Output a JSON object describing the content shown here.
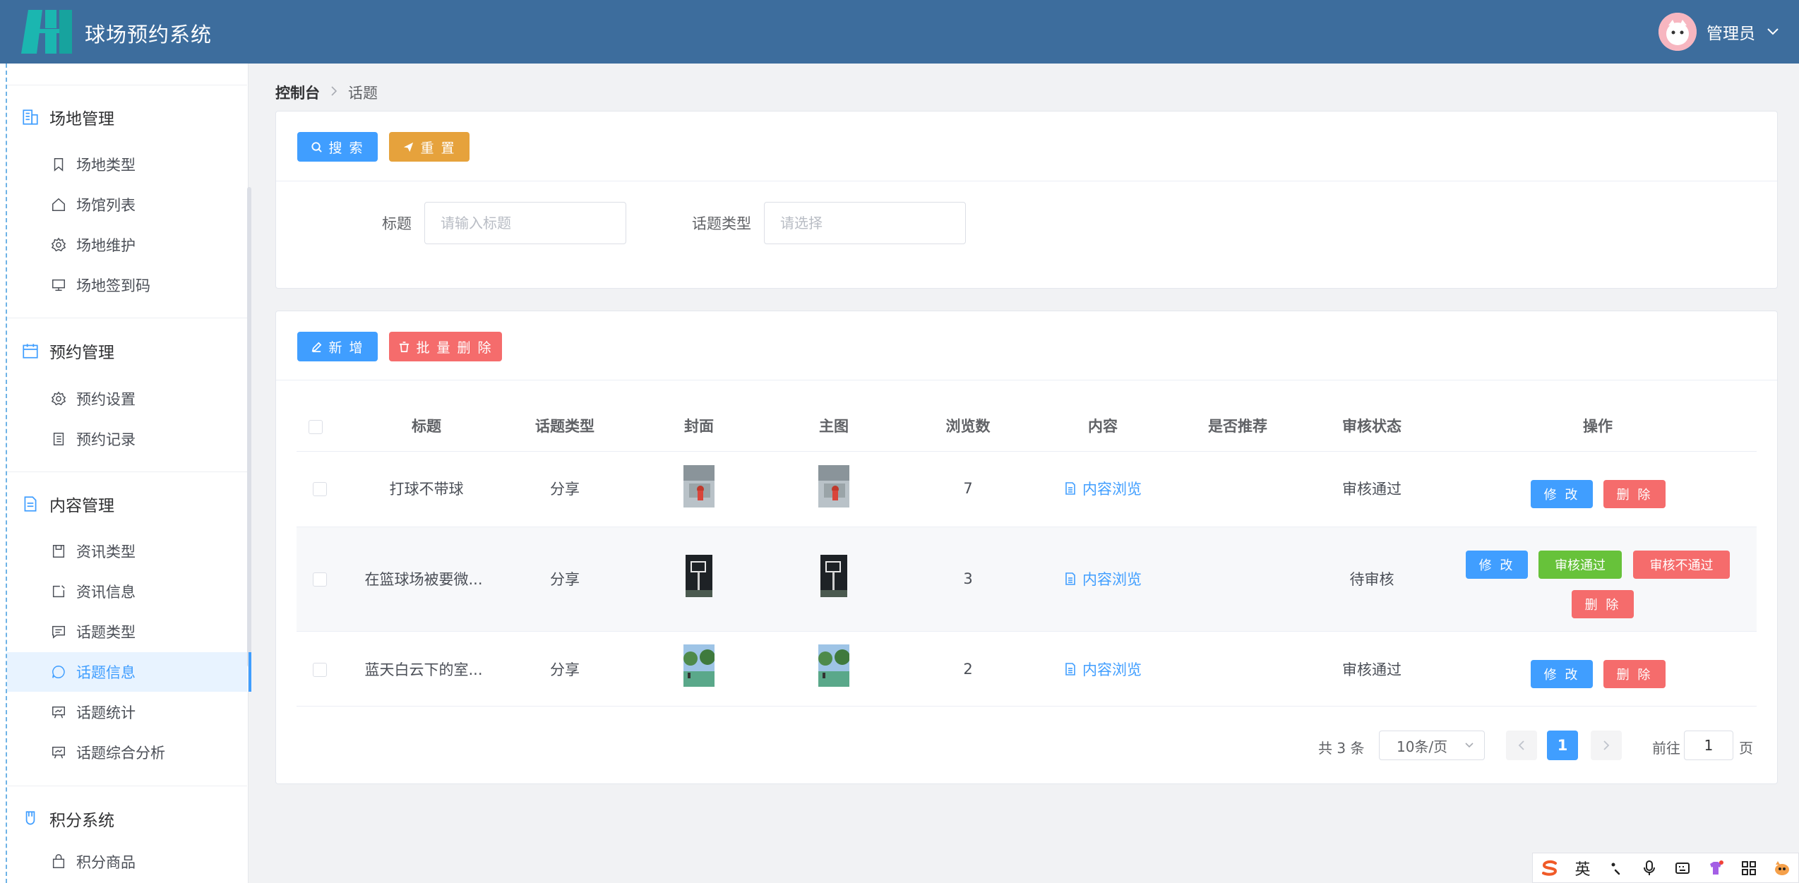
{
  "header": {
    "app_title": "球场预约系统",
    "user_name": "管理员",
    "brand_color": "#3d6d9d",
    "logo_color": "#1bb6b0"
  },
  "sidebar": {
    "groups": [
      {
        "title": "场地管理",
        "icon": "building-icon",
        "items": [
          {
            "label": "场地类型",
            "icon": "bookmark-icon"
          },
          {
            "label": "场馆列表",
            "icon": "home-icon"
          },
          {
            "label": "场地维护",
            "icon": "gear-icon"
          },
          {
            "label": "场地签到码",
            "icon": "monitor-icon"
          }
        ]
      },
      {
        "title": "预约管理",
        "icon": "calendar-icon",
        "items": [
          {
            "label": "预约设置",
            "icon": "gear-icon"
          },
          {
            "label": "预约记录",
            "icon": "notebook-icon"
          }
        ]
      },
      {
        "title": "内容管理",
        "icon": "document-icon",
        "items": [
          {
            "label": "资讯类型",
            "icon": "save-icon"
          },
          {
            "label": "资讯信息",
            "icon": "edit-box-icon"
          },
          {
            "label": "话题类型",
            "icon": "chat-square-icon"
          },
          {
            "label": "话题信息",
            "icon": "chat-round-icon",
            "active": true
          },
          {
            "label": "话题统计",
            "icon": "presentation-icon"
          },
          {
            "label": "话题综合分析",
            "icon": "presentation-icon"
          }
        ]
      },
      {
        "title": "积分系统",
        "icon": "medal-icon",
        "items": [
          {
            "label": "积分商品",
            "icon": "bag-icon"
          }
        ]
      }
    ]
  },
  "breadcrumb": {
    "home": "控制台",
    "current": "话题"
  },
  "search_panel": {
    "search_button": "搜 索",
    "reset_button": "重 置",
    "title_label": "标题",
    "title_placeholder": "请输入标题",
    "type_label": "话题类型",
    "type_placeholder": "请选择"
  },
  "table_toolbar": {
    "add_button": "新 增",
    "batch_delete_button": "批 量 删 除"
  },
  "table": {
    "columns": [
      "标题",
      "话题类型",
      "封面",
      "主图",
      "浏览数",
      "内容",
      "是否推荐",
      "审核状态",
      "操作"
    ],
    "rows": [
      {
        "title": "打球不带球",
        "type": "分享",
        "views": "7",
        "content_link": "内容浏览",
        "recommended": "",
        "status": "审核通过",
        "actions": [
          "修 改",
          "删 除"
        ]
      },
      {
        "title": "在篮球场被要微...",
        "type": "分享",
        "views": "3",
        "content_link": "内容浏览",
        "recommended": "",
        "status": "待审核",
        "actions": [
          "修 改",
          "审核通过",
          "审核不通过",
          "删 除"
        ]
      },
      {
        "title": "蓝天白云下的室...",
        "type": "分享",
        "views": "2",
        "content_link": "内容浏览",
        "recommended": "",
        "status": "审核通过",
        "actions": [
          "修 改",
          "删 除"
        ]
      }
    ]
  },
  "pagination": {
    "total_text": "共 3 条",
    "page_size": "10条/页",
    "current_page": "1",
    "goto_prefix": "前往",
    "goto_value": "1",
    "goto_suffix": "页"
  },
  "ime_toolbar": {
    "mode": "英"
  },
  "colors": {
    "primary": "#409eff",
    "warning": "#e6a23c",
    "danger": "#f56c6c",
    "success": "#67c23a"
  }
}
